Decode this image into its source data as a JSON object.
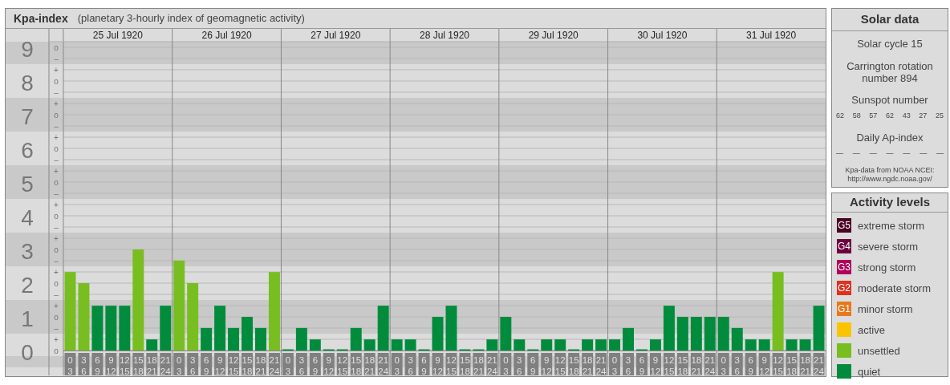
{
  "kpa_panel": {
    "title": "Kpa-index",
    "subtitle": "(planetary 3-hourly index of geomagnetic activity)",
    "days": [
      "25 Jul 1920",
      "26 Jul 1920",
      "27 Jul 1920",
      "28 Jul 1920",
      "29 Jul 1920",
      "30 Jul 1920",
      "31 Jul 1920"
    ],
    "chart_data": {
      "type": "bar",
      "stacked": true,
      "grid": true,
      "categories": [
        "0 3",
        "3 6",
        "6 9",
        "9 12",
        "12 15",
        "15 18",
        "18 21",
        "21 24",
        "0 3",
        "3 6",
        "6 9",
        "9 12",
        "12 15",
        "15 18",
        "18 21",
        "21 24",
        "0 3",
        "3 6",
        "6 9",
        "9 12",
        "12 15",
        "15 18",
        "18 21",
        "21 24",
        "0 3",
        "3 6",
        "6 9",
        "9 12",
        "12 15",
        "15 18",
        "18 21",
        "21 24",
        "0 3",
        "3 6",
        "6 9",
        "9 12",
        "12 15",
        "15 18",
        "18 21",
        "21 24",
        "0 3",
        "3 6",
        "6 9",
        "9 12",
        "12 15",
        "15 18",
        "18 21",
        "21 24",
        "0 3",
        "3 6",
        "6 9",
        "9 12",
        "12 15",
        "15 18",
        "18 21",
        "21 24"
      ],
      "ylim": [
        0,
        9
      ],
      "yticks": [
        {
          "value": 9,
          "label": "9"
        },
        {
          "value": 8,
          "label": "8"
        },
        {
          "value": 7,
          "label": "7"
        },
        {
          "value": 6,
          "label": "6"
        },
        {
          "value": 5,
          "label": "5"
        },
        {
          "value": 4,
          "label": "4"
        },
        {
          "value": 3,
          "label": "3"
        },
        {
          "value": 2,
          "label": "2"
        },
        {
          "value": 1,
          "label": "1"
        },
        {
          "value": 0,
          "label": "0"
        }
      ],
      "series": [
        {
          "color": "#008c3c",
          "values": [
            null,
            null,
            1.33,
            1.33,
            1.33,
            null,
            0.33,
            1.33,
            null,
            null,
            0.67,
            1.33,
            0.67,
            1,
            0.67,
            null,
            0,
            0.67,
            0.33,
            0,
            0,
            0.67,
            0.33,
            1.33,
            0.33,
            0.33,
            0,
            1,
            1.33,
            0,
            0,
            0.33,
            1,
            0.33,
            0,
            0.33,
            0.33,
            0,
            0.33,
            0.33,
            0.33,
            0.67,
            0,
            0.33,
            1.33,
            1,
            1,
            1,
            1,
            0.67,
            0.33,
            0.33,
            null,
            0.33,
            0.33,
            1.33
          ]
        },
        {
          "color": "#78be20",
          "values": [
            2.33,
            2,
            null,
            null,
            null,
            3,
            null,
            null,
            2.67,
            2,
            null,
            null,
            null,
            null,
            null,
            2.33,
            null,
            null,
            null,
            null,
            null,
            null,
            null,
            null,
            null,
            null,
            null,
            null,
            null,
            null,
            null,
            null,
            null,
            null,
            null,
            null,
            null,
            null,
            null,
            null,
            null,
            null,
            null,
            null,
            null,
            null,
            null,
            null,
            null,
            null,
            null,
            null,
            2.33,
            null,
            null,
            null
          ]
        }
      ]
    },
    "sub_ticks": [
      "o",
      "–",
      "+",
      "o",
      "–",
      "+",
      "o",
      "–",
      "+",
      "o",
      "–",
      "+",
      "o",
      "–",
      "+",
      "o",
      "–",
      "+",
      "o",
      "–",
      "+",
      "o",
      "–",
      "+",
      "o",
      "–",
      "+",
      "o"
    ]
  },
  "solar_data": {
    "title": "Solar data",
    "solar_cycle": "Solar cycle 15",
    "carrington": "Carrington rotation number 894",
    "sunspot_title": "Sunspot number",
    "sunspot_numbers": [
      "62",
      "58",
      "57",
      "62",
      "43",
      "27",
      "25"
    ],
    "ap_title": "Daily Ap-index",
    "ap_values": [
      "—",
      "—",
      "—",
      "—",
      "—",
      "—",
      "—"
    ],
    "source": "Kpa-data from NOAA NCEI: http://www.ngdc.noaa.gov/"
  },
  "activity_levels": {
    "title": "Activity levels",
    "items": [
      {
        "badge": "G5",
        "label": "extreme storm",
        "color": "#4a0022"
      },
      {
        "badge": "G4",
        "label": "severe storm",
        "color": "#6e0042"
      },
      {
        "badge": "G3",
        "label": "strong storm",
        "color": "#b0005c"
      },
      {
        "badge": "G2",
        "label": "moderate storm",
        "color": "#e0301e"
      },
      {
        "badge": "G1",
        "label": "minor storm",
        "color": "#e8781c"
      },
      {
        "label": "active",
        "color": "#fcc400"
      },
      {
        "label": "unsettled",
        "color": "#78be20"
      },
      {
        "label": "quiet",
        "color": "#008c3c"
      }
    ]
  }
}
